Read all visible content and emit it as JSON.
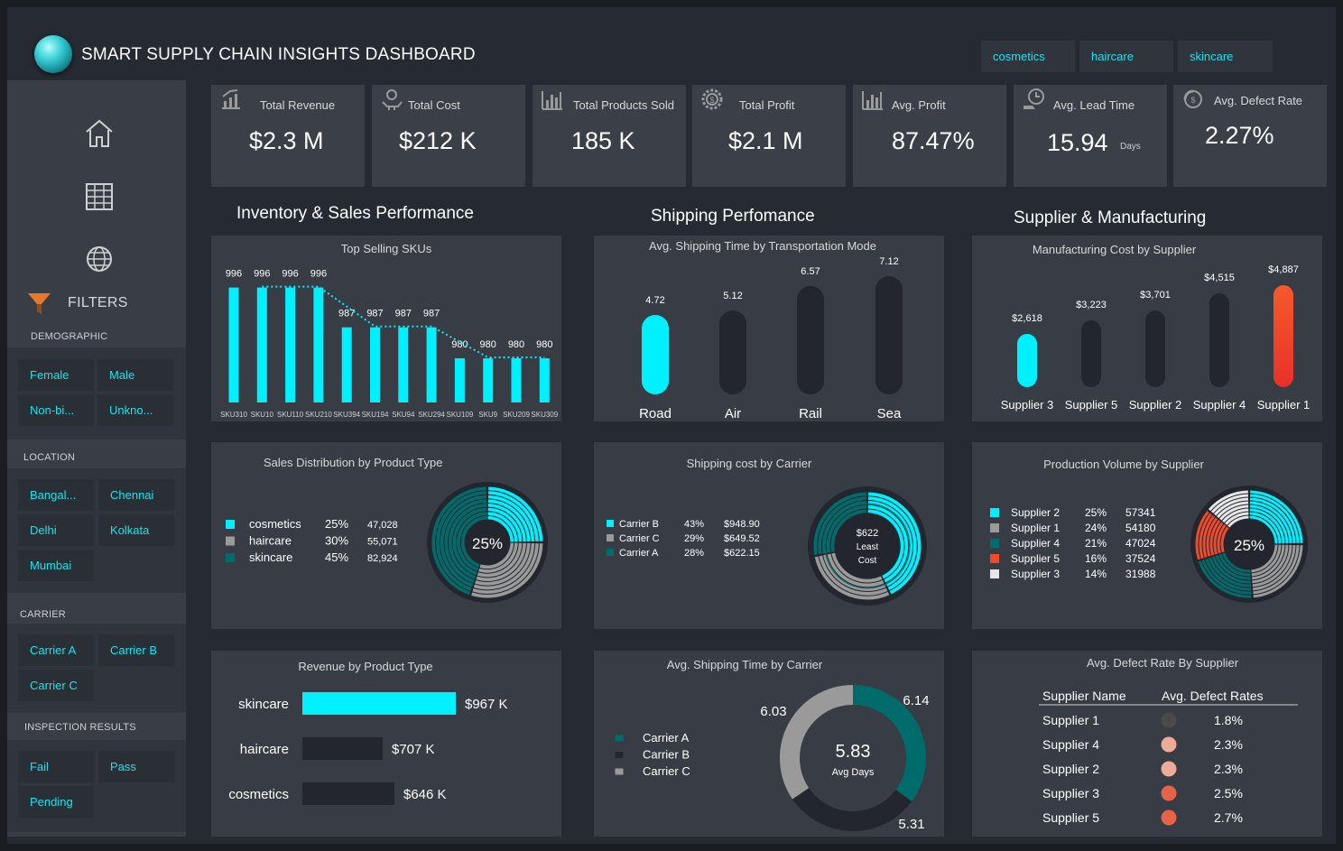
{
  "header": {
    "title": "SMART SUPPLY CHAIN INSIGHTS DASHBOARD",
    "chips": [
      "cosmetics",
      "haircare",
      "skincare"
    ]
  },
  "sidebar": {
    "filters_label": "FILTERS",
    "sections": {
      "demographic": {
        "label": "DEMOGRAPHIC",
        "options": [
          "Female",
          "Male",
          "Non-bi...",
          "Unkno..."
        ]
      },
      "location": {
        "label": "LOCATION",
        "options": [
          "Bangal...",
          "Chennai",
          "Delhi",
          "Kolkata",
          "Mumbai"
        ]
      },
      "carrier": {
        "label": "CARRIER",
        "options": [
          "Carrier A",
          "Carrier B",
          "Carrier C"
        ]
      },
      "inspection": {
        "label": "INSPECTION RESULTS",
        "options": [
          "Fail",
          "Pass",
          "Pending"
        ]
      }
    }
  },
  "kpis": [
    {
      "label": "Total Revenue",
      "value": "$2.3 M",
      "unit": "",
      "icon": "revenue-chart-icon"
    },
    {
      "label": "Total Cost",
      "value": "$212 K",
      "unit": "",
      "icon": "cost-hand-icon"
    },
    {
      "label": "Total Products Sold",
      "value": "185 K",
      "unit": "",
      "icon": "bar-chart-icon"
    },
    {
      "label": "Total Profit",
      "value": "$2.1 M",
      "unit": "",
      "icon": "profit-gear-icon"
    },
    {
      "label": "Avg. Profit",
      "value": "87.47%",
      "unit": "",
      "icon": "bar-chart-icon"
    },
    {
      "label": "Avg. Lead Time",
      "value": "15.94",
      "unit": "Days",
      "icon": "lead-time-icon"
    },
    {
      "label": "Avg. Defect Rate",
      "value": "2.27%",
      "unit": "",
      "icon": "defect-icon"
    }
  ],
  "sections": {
    "inventory": "Inventory & Sales Performance",
    "shipping": "Shipping Perfomance",
    "supplier": "Supplier & Manufacturing"
  },
  "colors": {
    "accent": "#00f0ff",
    "teal": "#006b6b",
    "dark_bar": "#23262e",
    "grey": "#9a9a9a",
    "red": "#f04a2a"
  },
  "chart_data": [
    {
      "id": "top-skus",
      "type": "bar",
      "title": "Top Selling SKUs",
      "categories": [
        "SKU310",
        "SKU10",
        "SKU110",
        "SKU210",
        "SKU394",
        "SKU194",
        "SKU94",
        "SKU294",
        "SKU109",
        "SKU9",
        "SKU209",
        "SKU309"
      ],
      "values": [
        996,
        996,
        996,
        996,
        987,
        987,
        987,
        987,
        980,
        980,
        980,
        980
      ],
      "ylim": [
        970,
        1000
      ]
    },
    {
      "id": "shipping-mode",
      "type": "bar",
      "title": "Avg. Shipping Time by Transportation Mode",
      "categories": [
        "Road",
        "Air",
        "Rail",
        "Sea"
      ],
      "values": [
        4.72,
        5.12,
        6.57,
        7.12
      ],
      "highlight": "Road"
    },
    {
      "id": "mfg-cost",
      "type": "bar",
      "title": "Manufacturing Cost by Supplier",
      "categories": [
        "Supplier 3",
        "Supplier 5",
        "Supplier 2",
        "Supplier 4",
        "Supplier 1"
      ],
      "values": [
        2618,
        3223,
        3701,
        4515,
        4887
      ],
      "labels": [
        "$2,618",
        "$3,223",
        "$3,701",
        "$4,515",
        "$4,887"
      ]
    },
    {
      "id": "sales-dist",
      "type": "pie",
      "title": "Sales Distribution by Product Type",
      "center": "25%",
      "series": [
        {
          "name": "cosmetics",
          "pct": "25%",
          "value": "47,028",
          "share": 25,
          "color": "#00f0ff"
        },
        {
          "name": "haircare",
          "pct": "30%",
          "value": "55,071",
          "share": 30,
          "color": "#9a9a9a"
        },
        {
          "name": "skincare",
          "pct": "45%",
          "value": "82,924",
          "share": 45,
          "color": "#006b6b"
        }
      ]
    },
    {
      "id": "shipping-cost",
      "type": "pie",
      "title": "Shipping cost by Carrier",
      "center": [
        "$622",
        "Least",
        "Cost"
      ],
      "series": [
        {
          "name": "Carrier B",
          "pct": "43%",
          "value": "$948.90",
          "share": 43,
          "color": "#00f0ff"
        },
        {
          "name": "Carrier C",
          "pct": "29%",
          "value": "$649.52",
          "share": 29,
          "color": "#9a9a9a"
        },
        {
          "name": "Carrier A",
          "pct": "28%",
          "value": "$622.15",
          "share": 28,
          "color": "#006b6b"
        }
      ]
    },
    {
      "id": "production-volume",
      "type": "pie",
      "title": "Production Volume by Supplier",
      "center": "25%",
      "series": [
        {
          "name": "Supplier 2",
          "pct": "25%",
          "value": "57341",
          "share": 25,
          "color": "#00f0ff"
        },
        {
          "name": "Supplier 1",
          "pct": "24%",
          "value": "54180",
          "share": 24,
          "color": "#9a9a9a"
        },
        {
          "name": "Supplier 4",
          "pct": "21%",
          "value": "47024",
          "share": 21,
          "color": "#006b6b"
        },
        {
          "name": "Supplier 5",
          "pct": "16%",
          "value": "37524",
          "share": 16,
          "color": "#f04a2a"
        },
        {
          "name": "Supplier 3",
          "pct": "14%",
          "value": "31988",
          "share": 14,
          "color": "#e6e6e6"
        }
      ]
    },
    {
      "id": "revenue-product",
      "type": "bar",
      "title": "Revenue by Product Type",
      "categories": [
        "skincare",
        "haircare",
        "cosmetics"
      ],
      "values": [
        967,
        707,
        646
      ],
      "labels": [
        "$967 K",
        "$707 K",
        "$646 K"
      ]
    },
    {
      "id": "shipping-time-carrier",
      "type": "pie",
      "title": "Avg. Shipping Time by Carrier",
      "center": [
        "5.83",
        "Avg Days"
      ],
      "series": [
        {
          "name": "Carrier A",
          "value": 6.14,
          "label": "6.14",
          "color": "#006b6b"
        },
        {
          "name": "Carrier B",
          "value": 5.31,
          "label": "5.31",
          "color": "#23262e"
        },
        {
          "name": "Carrier C",
          "value": 6.03,
          "label": "6.03",
          "color": "#9a9a9a"
        }
      ]
    },
    {
      "id": "defect-rate",
      "type": "table",
      "title": "Avg. Defect Rate By Supplier",
      "columns": [
        "Supplier Name",
        "Avg. Defect Rates"
      ],
      "rows": [
        {
          "name": "Supplier 1",
          "rate": "1.8%",
          "color": "#4a4a4a"
        },
        {
          "name": "Supplier 4",
          "rate": "2.3%",
          "color": "#f0aa98"
        },
        {
          "name": "Supplier 2",
          "rate": "2.3%",
          "color": "#f0aa98"
        },
        {
          "name": "Supplier 3",
          "rate": "2.5%",
          "color": "#e8624a"
        },
        {
          "name": "Supplier 5",
          "rate": "2.7%",
          "color": "#e8624a"
        }
      ]
    }
  ]
}
